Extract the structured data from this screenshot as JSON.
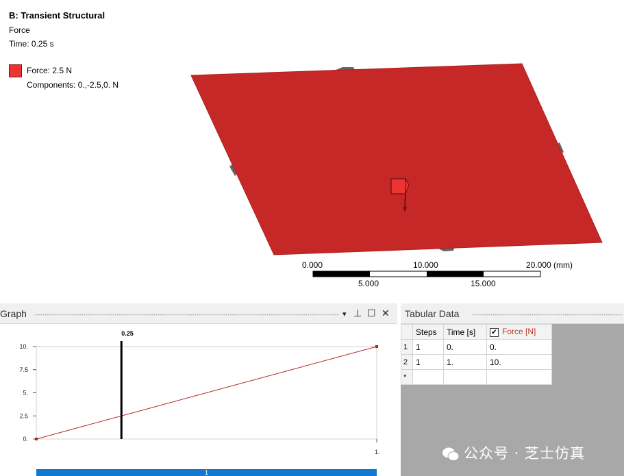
{
  "viewport": {
    "title": "B: Transient Structural",
    "object": "Force",
    "time": "Time: 0.25 s",
    "legend_force": "Force: 2.5 N",
    "legend_components": "Components: 0.,-2.5,0. N",
    "force_color": "#ee3333",
    "plate_color": "#c62828",
    "scale": {
      "top_labels": [
        "0.000",
        "10.000",
        "20.000 (mm)"
      ],
      "bottom_labels": [
        "5.000",
        "15.000"
      ]
    }
  },
  "graph": {
    "title": "Graph",
    "buttons": {
      "dropdown": "▾",
      "pin": "⊥",
      "maximize": "☐",
      "close": "✕"
    },
    "cursor_label": "0.25",
    "timeline_label": "1",
    "chart_data": {
      "type": "line",
      "x": [
        0,
        1
      ],
      "series": [
        {
          "values": [
            0,
            10
          ],
          "color": "#b22222"
        }
      ],
      "ylim": [
        0,
        10
      ],
      "xlim": [
        0,
        1
      ],
      "yticks": [
        "0.",
        "2.5",
        "5.",
        "7.5",
        "10."
      ],
      "xtick_end": "1.",
      "cursor_x": 0.25
    }
  },
  "tabular": {
    "title": "Tabular Data",
    "columns": [
      "Steps",
      "Time [s]",
      "Force [N]"
    ],
    "rows": [
      {
        "n": "1",
        "steps": "1",
        "time": "0.",
        "force": "0."
      },
      {
        "n": "2",
        "steps": "1",
        "time": "1.",
        "force": "10."
      },
      {
        "n": "*",
        "steps": "",
        "time": "",
        "force": ""
      }
    ]
  },
  "watermark": "公众号 · 芝士仿真"
}
